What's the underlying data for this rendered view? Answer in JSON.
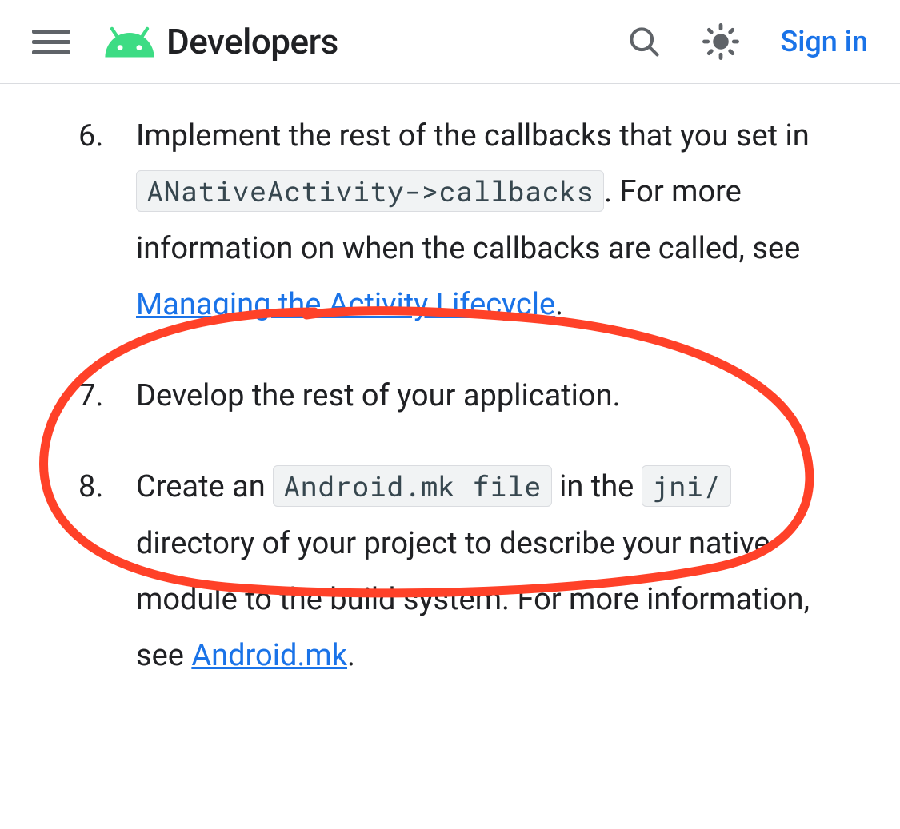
{
  "header": {
    "brand": "Developers",
    "sign_in": "Sign in"
  },
  "list": {
    "start": 6,
    "items": [
      {
        "text_1": "Implement the rest of the callbacks that you set in ",
        "code_1": "ANativeActivity->callbacks",
        "text_2": ". For more information on when the callbacks are called, see ",
        "link_1": "Managing the Activity Lifecycle",
        "text_3": "."
      },
      {
        "text_1": "Develop the rest of your application."
      },
      {
        "text_1": "Create an ",
        "code_1": "Android.mk file",
        "text_2": " in the ",
        "code_2": "jni/",
        "text_3": " directory of your project to describe your native module to the build system. For more information, see ",
        "link_1": "Android.mk",
        "text_4": "."
      }
    ]
  }
}
